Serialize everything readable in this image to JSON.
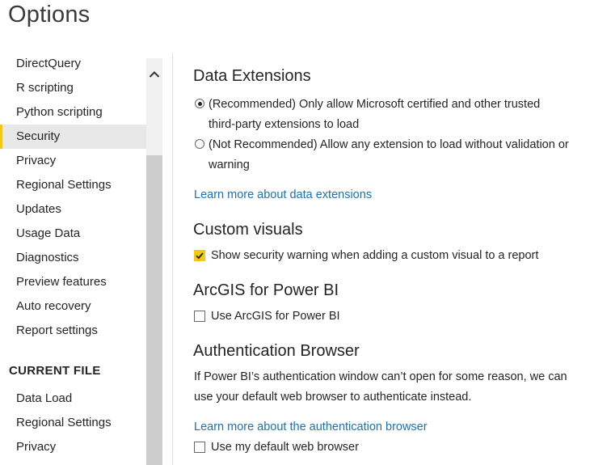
{
  "window": {
    "title": "Options"
  },
  "sidebar": {
    "global_items": [
      {
        "label": "DirectQuery"
      },
      {
        "label": "R scripting"
      },
      {
        "label": "Python scripting"
      },
      {
        "label": "Security",
        "selected": true
      },
      {
        "label": "Privacy"
      },
      {
        "label": "Regional Settings"
      },
      {
        "label": "Updates"
      },
      {
        "label": "Usage Data"
      },
      {
        "label": "Diagnostics"
      },
      {
        "label": "Preview features"
      },
      {
        "label": "Auto recovery"
      },
      {
        "label": "Report settings"
      }
    ],
    "current_file_header": "CURRENT FILE",
    "current_file_items": [
      {
        "label": "Data Load"
      },
      {
        "label": "Regional Settings"
      },
      {
        "label": "Privacy"
      }
    ]
  },
  "content": {
    "data_extensions": {
      "heading": "Data Extensions",
      "option_recommended_line1": "(Recommended) Only allow Microsoft certified and other trusted",
      "option_recommended_line2": "third-party extensions to load",
      "option_not_recommended_line1": "(Not Recommended) Allow any extension to load without validation or",
      "option_not_recommended_line2": "warning",
      "learn_more": "Learn more about data extensions"
    },
    "custom_visuals": {
      "heading": "Custom visuals",
      "checkbox_label": "Show security warning when adding a custom visual to a report"
    },
    "arcgis": {
      "heading": "ArcGIS for Power BI",
      "checkbox_label": "Use ArcGIS for Power BI"
    },
    "auth_browser": {
      "heading": "Authentication Browser",
      "description_line1": "If Power BI’s authentication window can’t open for some reason, we can",
      "description_line2": "use your default web browser to authenticate instead.",
      "learn_more": "Learn more about the authentication browser",
      "checkbox_label": "Use my default web browser"
    }
  },
  "colors": {
    "accent": "#f2c811",
    "link": "#1f6fb5",
    "selected_bg": "#e8e8e8",
    "scroll_thumb": "#cdcdcd"
  }
}
